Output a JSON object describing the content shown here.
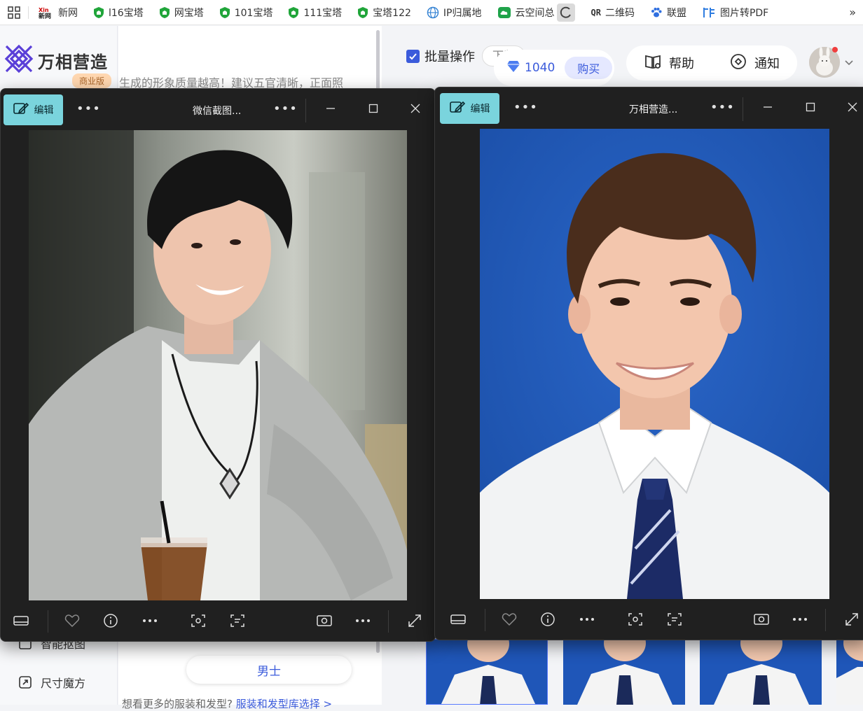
{
  "bookmarks": {
    "items": [
      {
        "label": "新网",
        "icon": "xinnet-icon"
      },
      {
        "label": "l16宝塔",
        "icon": "baota-shield-icon"
      },
      {
        "label": "网宝塔",
        "icon": "baota-shield-icon"
      },
      {
        "label": "101宝塔",
        "icon": "baota-shield-icon"
      },
      {
        "label": "111宝塔",
        "icon": "baota-shield-icon"
      },
      {
        "label": "宝塔122",
        "icon": "baota-shield-icon"
      },
      {
        "label": "IP归属地",
        "icon": "globe-icon"
      },
      {
        "label": "云空间总",
        "icon": "cloud-icon"
      },
      {
        "label": "二维码",
        "icon": "qr-icon"
      },
      {
        "label": "联盟",
        "icon": "paw-icon"
      },
      {
        "label": "图片转PDF",
        "icon": "pdf-icon"
      }
    ],
    "qr_prefix": "QR",
    "more": "»"
  },
  "site": {
    "logo_text": "万相营造",
    "edition_badge": "商业版",
    "tip": "生成的形象质量越高！建议五官清晰，正面照",
    "batch_label": "批量操作",
    "download_label": "下载",
    "points": "1040",
    "buy_label": "购买",
    "help_label": "帮助",
    "notify_label": "通知",
    "nav": [
      {
        "label": "智能抠图"
      },
      {
        "label": "尺寸魔方"
      }
    ],
    "gender_option": "男士",
    "bottom_note": "想看更多的服装和发型?",
    "bottom_link": "服装和发型库选择 >"
  },
  "viewer_left": {
    "edit_label": "编辑",
    "title": "微信截图..."
  },
  "viewer_right": {
    "edit_label": "编辑",
    "title": "万相营造..."
  },
  "colors": {
    "accent": "#3b5bdb",
    "edit_button": "#7ad4dd",
    "viewer_bg": "#202020",
    "id_photo_bg": "#1f56b8"
  }
}
